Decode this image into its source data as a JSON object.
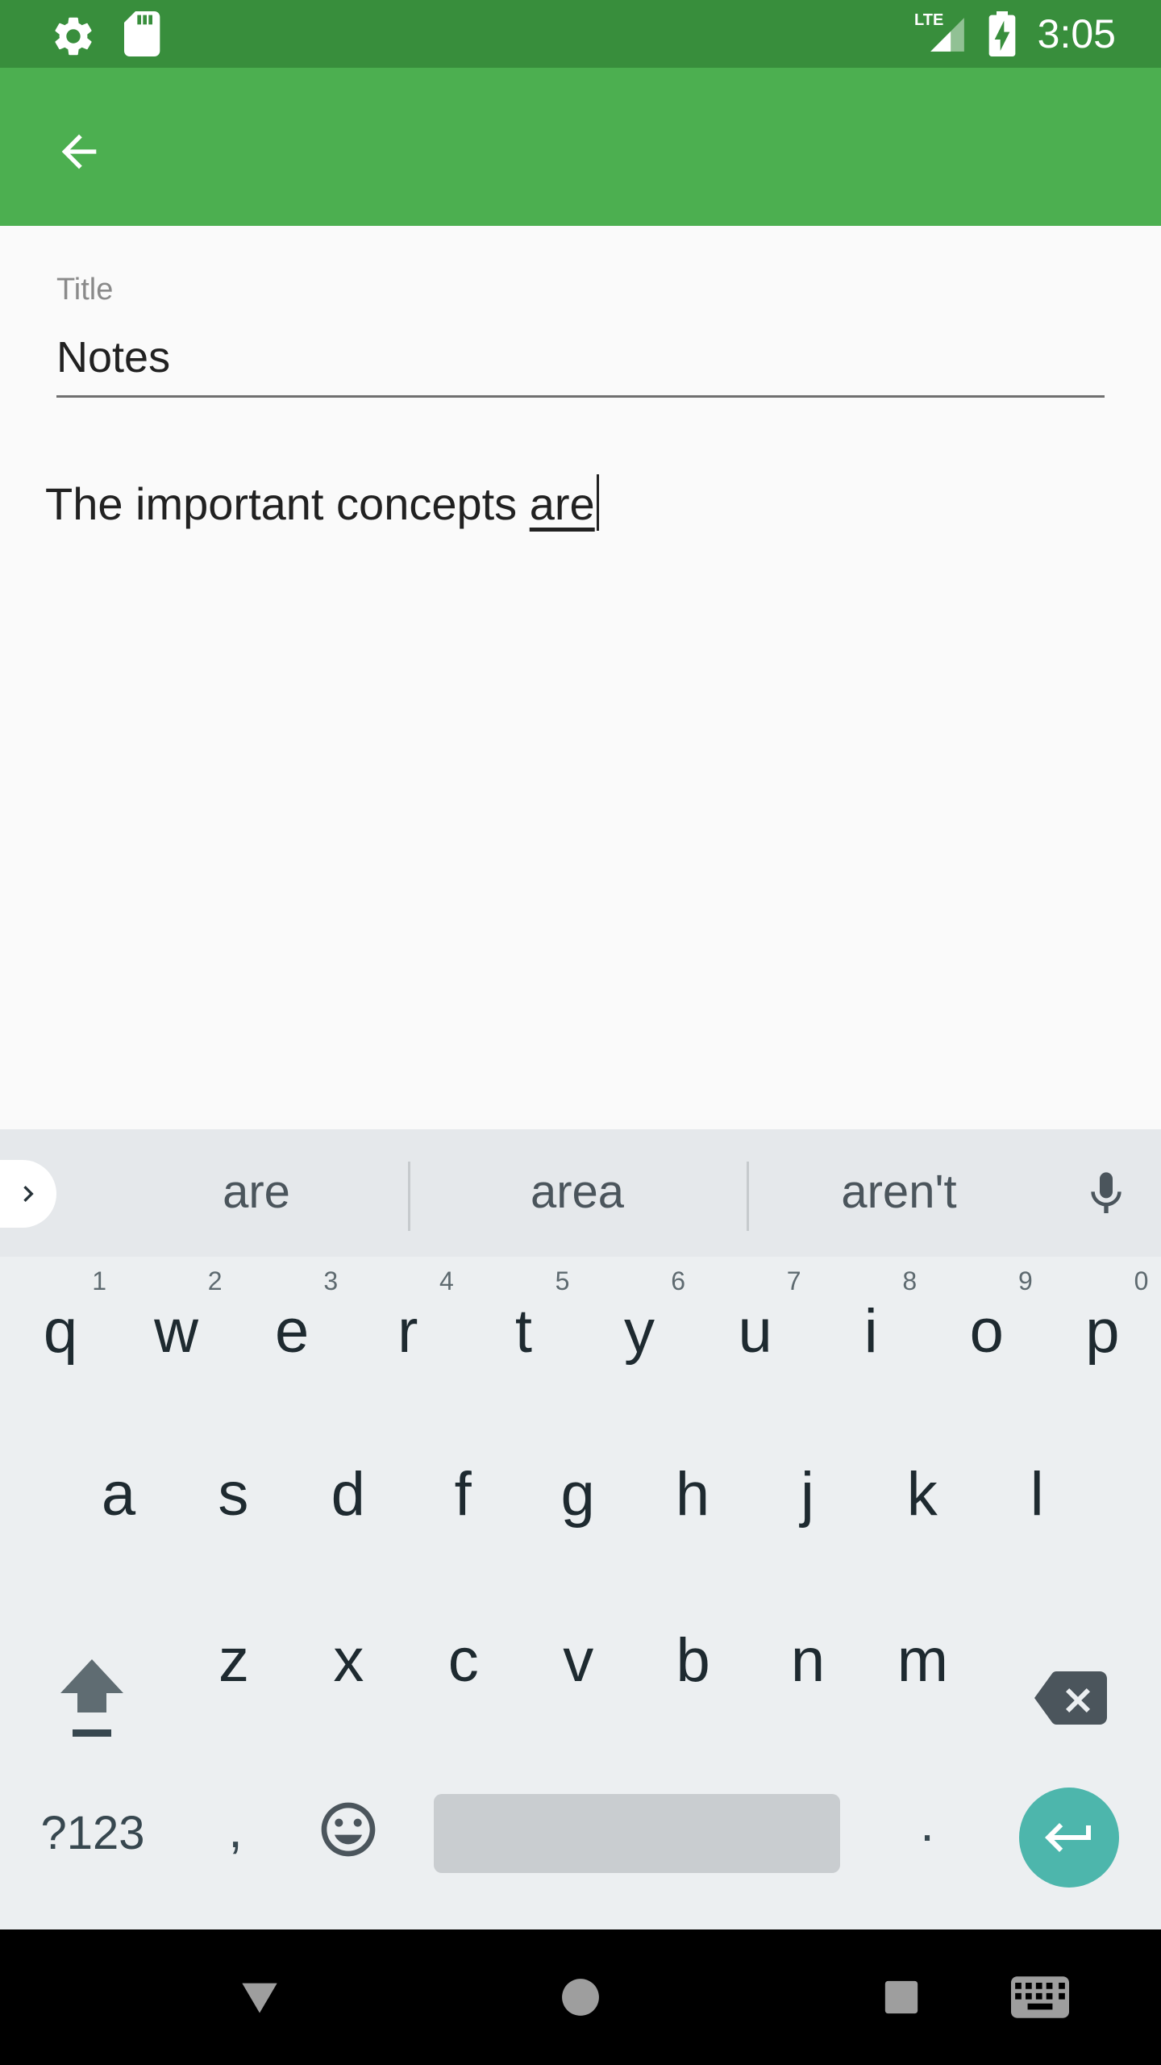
{
  "status_bar": {
    "time": "3:05",
    "network": "LTE",
    "icons": [
      "settings-icon",
      "sd-card-icon",
      "signal-icon",
      "battery-charging-icon"
    ]
  },
  "app_bar": {
    "back_icon": "arrow-back-icon"
  },
  "note": {
    "title_label": "Title",
    "title_value": "Notes",
    "body_text_before": "The important concepts ",
    "body_text_composing": "are"
  },
  "keyboard": {
    "suggestions": [
      "are",
      "area",
      "aren't"
    ],
    "row1": [
      {
        "key": "q",
        "hint": "1"
      },
      {
        "key": "w",
        "hint": "2"
      },
      {
        "key": "e",
        "hint": "3"
      },
      {
        "key": "r",
        "hint": "4"
      },
      {
        "key": "t",
        "hint": "5"
      },
      {
        "key": "y",
        "hint": "6"
      },
      {
        "key": "u",
        "hint": "7"
      },
      {
        "key": "i",
        "hint": "8"
      },
      {
        "key": "o",
        "hint": "9"
      },
      {
        "key": "p",
        "hint": "0"
      }
    ],
    "row2": [
      "a",
      "s",
      "d",
      "f",
      "g",
      "h",
      "j",
      "k",
      "l"
    ],
    "row3": [
      "z",
      "x",
      "c",
      "v",
      "b",
      "n",
      "m"
    ],
    "symbols_label": "?123",
    "comma": ",",
    "period": ".",
    "accent_color": "#4db6ac"
  },
  "colors": {
    "status_bar": "#388e3c",
    "app_bar": "#4caf50"
  }
}
